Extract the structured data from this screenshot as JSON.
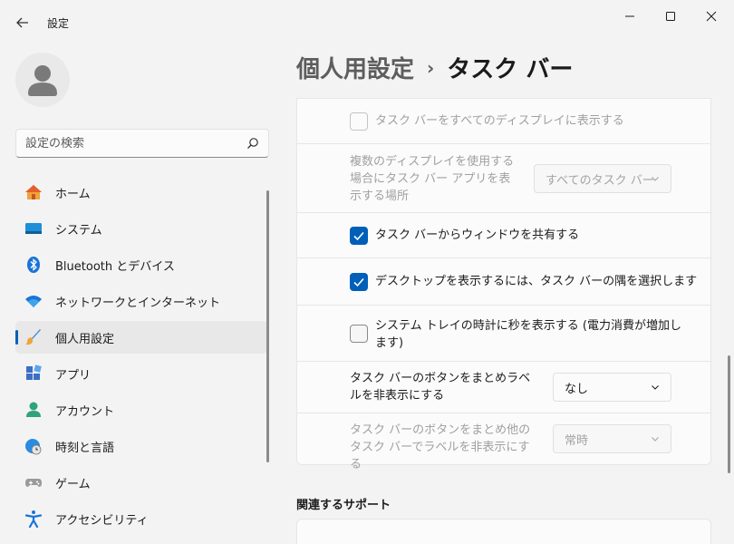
{
  "window": {
    "title": "設定",
    "controls": [
      "minimize-icon",
      "maximize-icon",
      "close-icon"
    ]
  },
  "search": {
    "placeholder": "設定の検索"
  },
  "sidebar": {
    "items": [
      {
        "label": "ホーム",
        "icon": "home-icon"
      },
      {
        "label": "システム",
        "icon": "system-icon"
      },
      {
        "label": "Bluetooth とデバイス",
        "icon": "bluetooth-icon"
      },
      {
        "label": "ネットワークとインターネット",
        "icon": "wifi-icon"
      },
      {
        "label": "個人用設定",
        "icon": "brush-icon",
        "active": true
      },
      {
        "label": "アプリ",
        "icon": "apps-icon"
      },
      {
        "label": "アカウント",
        "icon": "account-icon"
      },
      {
        "label": "時刻と言語",
        "icon": "clock-globe-icon"
      },
      {
        "label": "ゲーム",
        "icon": "gamepad-icon"
      },
      {
        "label": "アクセシビリティ",
        "icon": "accessibility-icon"
      }
    ]
  },
  "breadcrumb": {
    "parent": "個人用設定",
    "separator": "›",
    "current": "タスク バー"
  },
  "settings": {
    "show_on_all_displays": {
      "label": "タスク バーをすべてのディスプレイに表示する",
      "checked": false,
      "disabled": true
    },
    "multi_display_apps": {
      "label": "複数のディスプレイを使用する場合にタスク バー アプリを表示する場所",
      "value": "すべてのタスク バー",
      "disabled": true
    },
    "share_window": {
      "label": "タスク バーからウィンドウを共有する",
      "checked": true
    },
    "show_desktop_corner": {
      "label": "デスクトップを表示するには、タスク バーの隅を選択します",
      "checked": true
    },
    "clock_seconds": {
      "label": "システム トレイの時計に秒を表示する (電力消費が増加します)",
      "checked": false
    },
    "combine_buttons": {
      "label": "タスク バーのボタンをまとめラベルを非表示にする",
      "value": "なし"
    },
    "combine_other": {
      "label": "タスク バーのボタンをまとめ他のタスク バーでラベルを非表示にする",
      "value": "常時",
      "disabled": true
    }
  },
  "related": {
    "title": "関連するサポート"
  },
  "colors": {
    "accent": "#005fb8",
    "background": "#f3f3f3",
    "card": "#fbfbfb"
  }
}
